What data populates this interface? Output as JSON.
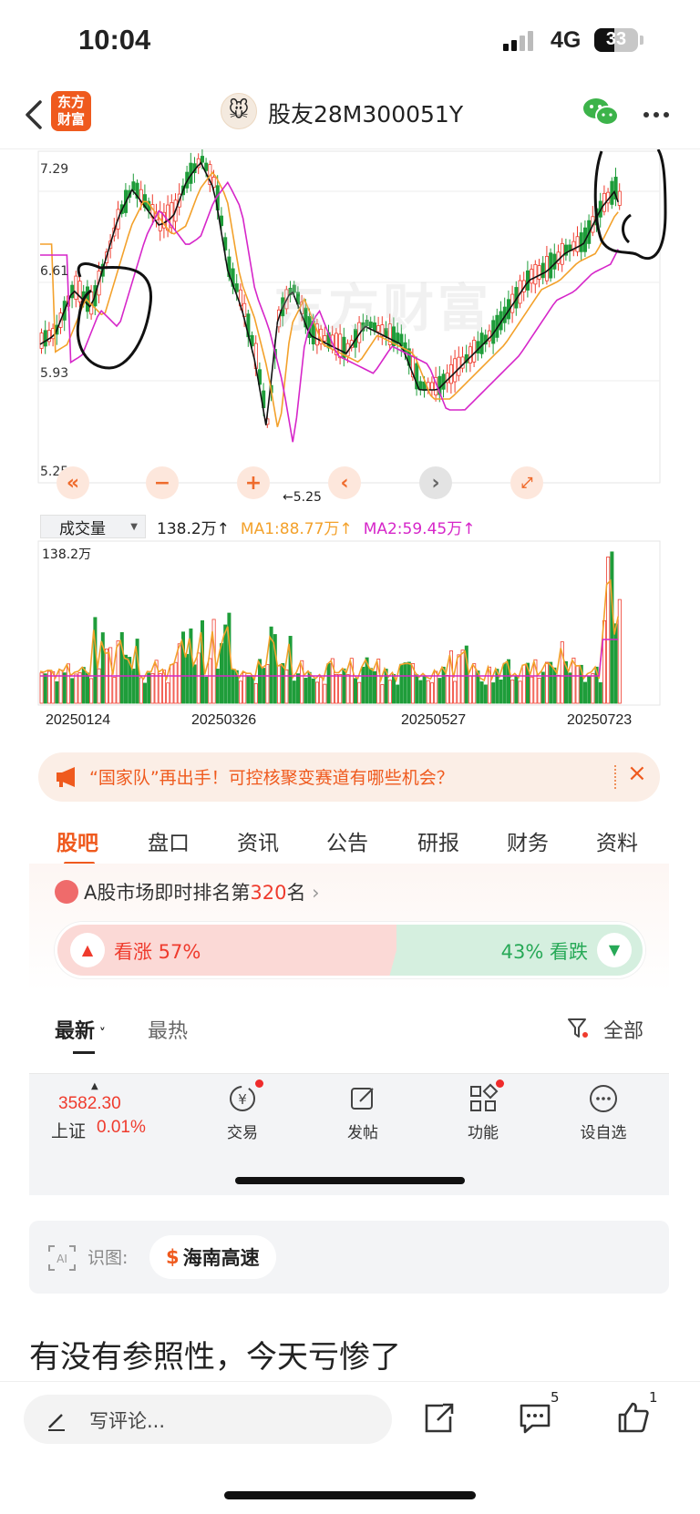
{
  "status": {
    "time": "10:04",
    "network": "4G",
    "battery": "33"
  },
  "header": {
    "logo_text": "东方\n财富",
    "title": "股友28M300051Y"
  },
  "kline": {
    "price_labels": [
      "7.29",
      "6.61",
      "5.93",
      "5.25"
    ],
    "low_marker": "←5.25",
    "watermark": "东方财富"
  },
  "volume": {
    "selector_label": "成交量",
    "current": "138.2万↑",
    "ma1": "MA1:88.77万↑",
    "ma2": "MA2:59.45万↑",
    "max_label": "138.2万",
    "dates": [
      "20250124",
      "20250326",
      "20250527",
      "20250723"
    ]
  },
  "banner": {
    "text": "“国家队”再出手！可控核聚变赛道有哪些机会？",
    "close": "×"
  },
  "tabs": [
    "股吧",
    "盘口",
    "资讯",
    "公告",
    "研报",
    "财务",
    "资料"
  ],
  "rank": {
    "prefix": "A股市场即时排名第",
    "number": "320",
    "suffix": "名",
    "arrow": "›"
  },
  "vote": {
    "up_label": "看涨 57%",
    "down_label": "43% 看跌",
    "up_ratio": 0.57,
    "down_ratio": 0.43
  },
  "sort": {
    "latest": "最新",
    "hot": "最热",
    "filter": "全部"
  },
  "toolbar": {
    "index_value": "3582.30",
    "index_name": "上证",
    "index_change": "0.01%",
    "items": [
      "交易",
      "发帖",
      "功能",
      "设自选"
    ]
  },
  "ocr": {
    "label": "识图:",
    "chip_symbol": "$",
    "chip_text": "海南高速"
  },
  "post": {
    "text": "有没有参照性，今天亏惨了"
  },
  "comment": {
    "placeholder": "写评论...",
    "comment_count": "5",
    "like_count": "1"
  },
  "colors": {
    "up": "#ef3b2d",
    "down": "#1f9d3a",
    "accent": "#ef5a1e",
    "ma1": "#f3a12b",
    "ma2": "#d626c9"
  }
}
